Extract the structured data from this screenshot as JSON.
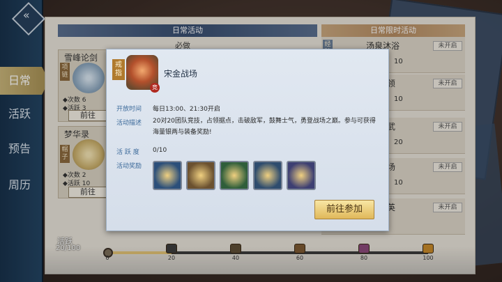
{
  "nav": {
    "items": [
      "日常",
      "活跃",
      "预告",
      "周历"
    ],
    "active_index": 0
  },
  "left_col": {
    "header": "日常活动",
    "subheader": "必做",
    "cards": [
      {
        "title": "雪峰论剑",
        "tag": "项链",
        "stat1_label": "◆次数",
        "stat1_val": "6",
        "stat2_label": "◆活跃",
        "stat2_val": "3",
        "button": "前往"
      },
      {
        "title": "梦华录",
        "tag": "帽子",
        "stat1_label": "◆次数",
        "stat1_val": "2",
        "stat2_label": "◆活跃",
        "stat2_val": "10",
        "button": "前往"
      }
    ]
  },
  "right_col": {
    "header": "日常限时活动",
    "rows": [
      {
        "title": "汤泉沐浴",
        "tag": "经验",
        "value": "10",
        "state": "未开启"
      },
      {
        "title": "领",
        "tag": "",
        "value": "10",
        "state": "未开启"
      },
      {
        "title": "武",
        "tag": "",
        "value": "20",
        "state": "未开启"
      },
      {
        "title": "场",
        "tag": "",
        "value": "10",
        "state": "未开启"
      },
      {
        "title": "英",
        "tag": "",
        "value": "",
        "state": "未开启"
      }
    ]
  },
  "activity": {
    "label": "活跃",
    "value": "20/100",
    "progress": 0.2,
    "ticks": [
      "0",
      "20",
      "40",
      "60",
      "80",
      "100"
    ],
    "chest_colors": [
      "#3d3d3d",
      "#5e4f36",
      "#7d5a32",
      "#8c4a7a",
      "#c88a2a"
    ]
  },
  "popup": {
    "tag": "戒指",
    "badge": "竞",
    "title": "宋金战场",
    "time_label": "开放时间",
    "time_value": "每日13:00、21:30开启",
    "desc_label": "活动描述",
    "desc_value": "20对20团队竞技，占领据点，击破敌军，鼓舞士气，勇登战场之巅。参与可获得海量银两与装备奖励!",
    "active_label": "活 跃 度",
    "active_value": "0/10",
    "reward_label": "活动奖励",
    "reward_colors": [
      "#2b4f7a",
      "#6b5130",
      "#2f5e3a",
      "#2e4c6e",
      "#3d3f72"
    ],
    "join_button": "前往参加"
  }
}
